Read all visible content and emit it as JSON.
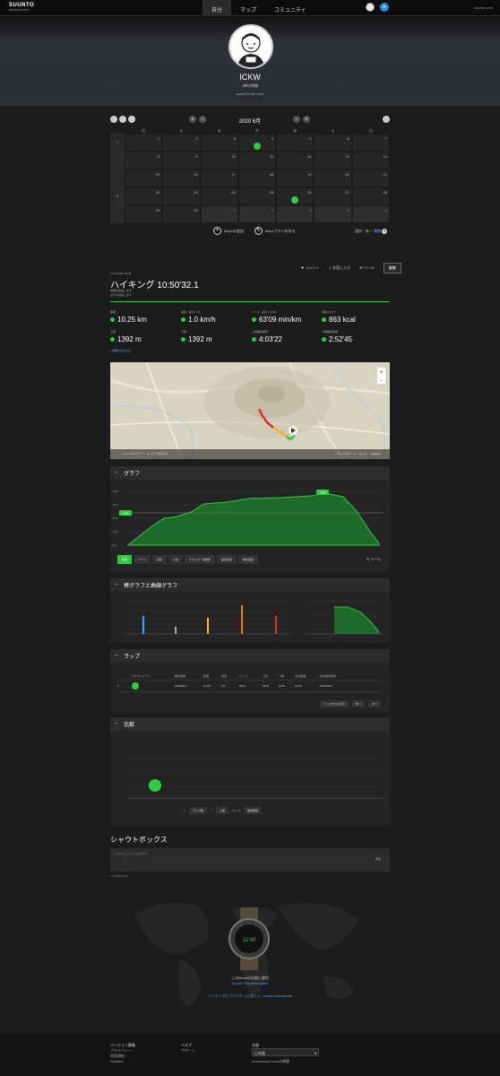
{
  "header": {
    "logo": "SUUNTO",
    "logo_sub": "MOVESCOUNT",
    "nav": [
      "自分",
      "マップ",
      "コミュニティ"
    ],
    "right_link": "suunto.com"
  },
  "profile": {
    "name": "ICKW",
    "subtitle": "1時の時間",
    "website": "www.for-ictu.com"
  },
  "calendar": {
    "title": "2020 6月",
    "weekdays": [
      "月",
      "火",
      "水",
      "木",
      "金",
      "土",
      "日"
    ],
    "weeks": [
      {
        "num": "1",
        "days": [
          "1",
          "2",
          "3",
          "4",
          "5",
          "6",
          "7"
        ]
      },
      {
        "num": "",
        "days": [
          "8",
          "9",
          "10",
          "11",
          "12",
          "13",
          "14"
        ]
      },
      {
        "num": "",
        "days": [
          "15",
          "16",
          "17",
          "18",
          "19",
          "20",
          "21"
        ]
      },
      {
        "num": "5",
        "days": [
          "22",
          "23",
          "24",
          "25",
          "26",
          "27",
          "28"
        ]
      },
      {
        "num": "",
        "days": [
          "29",
          "30",
          "1",
          "2",
          "3",
          "4",
          "5"
        ]
      }
    ],
    "add_move": "Moveの追加",
    "plan_move": "Moveプランを作る",
    "filter": "選択：唯一",
    "filter_link": "種類"
  },
  "activity": {
    "actions": [
      "コメント",
      "お気に入り",
      "ツール"
    ],
    "edit": "編集",
    "date": "17.06.2020 03:45",
    "title": "ハイキング 10:50'32.1",
    "desc1": "説明を追加します",
    "desc2": "タグを追加します",
    "stats": [
      {
        "label": "距離",
        "value": "10.25 km"
      },
      {
        "label": "速度（最大 4.4）",
        "value": "1.0 km/h"
      },
      {
        "label": "ペース（最大 13:35）",
        "value": "63'09 min/km"
      },
      {
        "label": "消費カロリー",
        "value": "863 kcal"
      },
      {
        "label": "上昇",
        "value": "1392 m"
      },
      {
        "label": "下降",
        "value": "1392 m"
      },
      {
        "label": "上昇継続時間",
        "value": "4:03'22"
      },
      {
        "label": "下降継続時間",
        "value": "2:52'45"
      }
    ],
    "more": "詳細を表示する"
  },
  "map": {
    "bar_left": "フォトギャラリー：マップで表示する",
    "bar_right": "トラックチャート・マップ  ・  Mapbox"
  },
  "graph": {
    "title": "グラフ",
    "tabs": [
      "高度",
      "ペース",
      "速度",
      "心拍",
      "エネルギー消費量",
      "垂直速度",
      "継続温度"
    ],
    "tool": "ツール",
    "max_label": "2298",
    "cur_label": "1698"
  },
  "zones": {
    "title": "棒グラフと曲線グラフ"
  },
  "laps": {
    "title": "ラップ",
    "headers": [
      "アクティビティ",
      "継続時間",
      "距離",
      "速度",
      "ペース",
      "上昇",
      "下降",
      "合計距離",
      "合計継続時間"
    ],
    "row": [
      "1",
      "",
      "10:50'32.1",
      "10.25",
      "0.9",
      "63'27",
      "1278",
      "1278",
      "10.25",
      "10:50'32.1"
    ],
    "select": "ラップ付きの表示",
    "prev": "前へ",
    "next": "次へ"
  },
  "compare": {
    "title": "比較",
    "x_label": "X",
    "x_value": "ラップ数",
    "y_label": "Y",
    "y_value": "上昇",
    "size_label": "サイズ",
    "size_value": "継続時間"
  },
  "shoutbox": {
    "title": "シャウトボックス",
    "placeholder": "このMoveについての感想を...",
    "send": "送信",
    "note": "1,000文字以内"
  },
  "device": {
    "caption": "このMoveの記録に使用",
    "model": "Suunto Traverse Alpha",
    "link": "ハイキングについてもっと詳しく: suunto.com/sports"
  },
  "footer": {
    "col1": [
      "バージョン情報",
      "プライバシー",
      "利用規約",
      "Cookies"
    ],
    "col2": [
      "ヘルプ",
      "サポート"
    ],
    "col3_label": "言語",
    "language": "日本語",
    "col3_extra": "movescount.comの概要"
  },
  "colors": {
    "accent": "#2ecc40",
    "background": "#1c1c1c"
  }
}
